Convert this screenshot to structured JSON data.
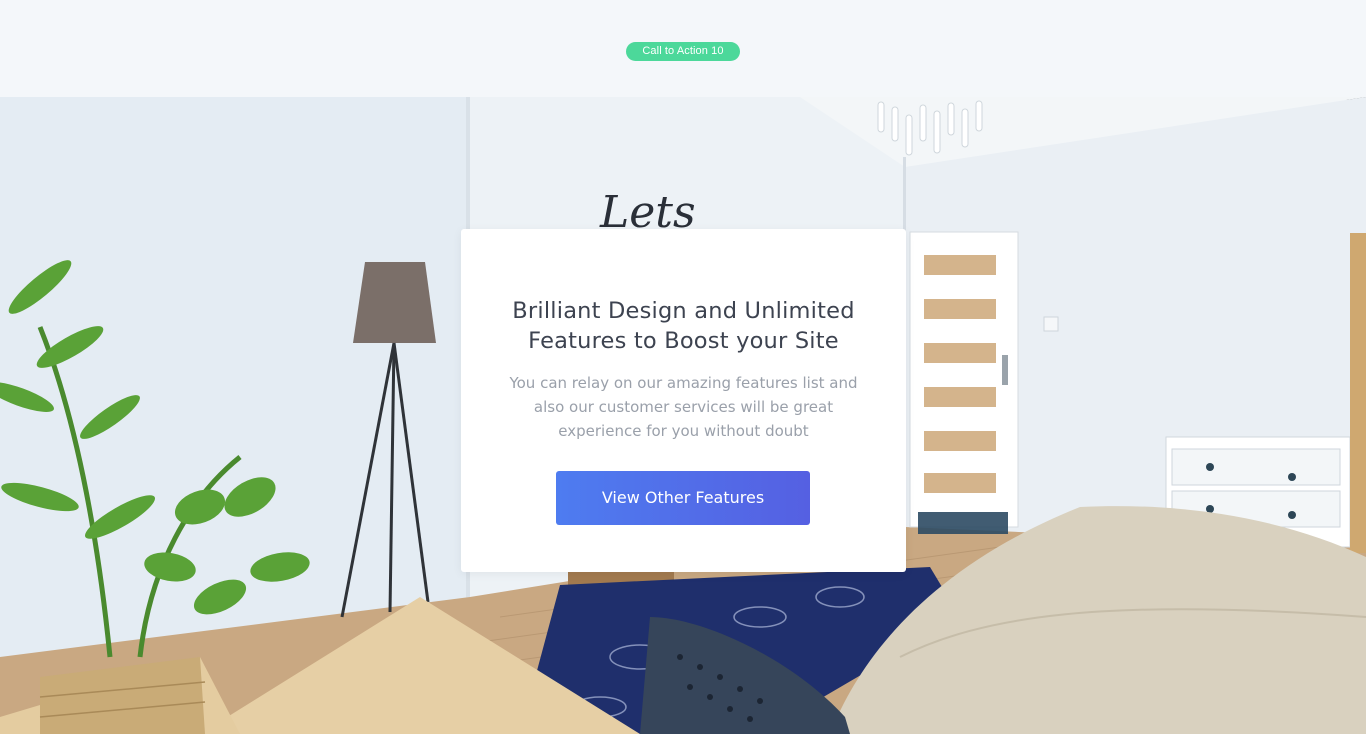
{
  "header": {
    "badge_label": "Call to Action 10"
  },
  "cta_card": {
    "title_line1": "Brilliant Design and Unlimited",
    "title_line2": "Features to Boost your Site",
    "description_line1": "You can relay on our amazing features list and",
    "description_line2": "also our customer services will be great",
    "description_line3": "experience for you without doubt",
    "button_label": "View Other Features"
  },
  "background": {
    "wall_lettering": "Lets"
  },
  "colors": {
    "badge": "#4cd89a",
    "button_start": "#4e7cf0",
    "button_end": "#5560e2",
    "title": "#3d4350",
    "body_text": "#9aa0aa"
  }
}
